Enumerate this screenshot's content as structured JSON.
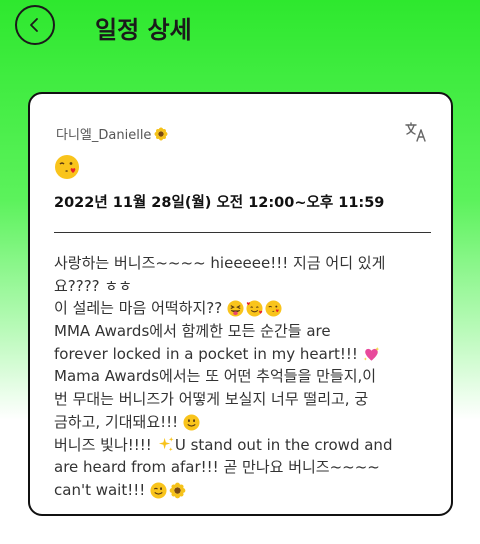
{
  "header": {
    "title": "일정 상세"
  },
  "card": {
    "author": "다니엘_Danielle",
    "datetime": "2022년 11월 28일(월) 오전 12:00~오후 11:59",
    "lines": [
      "사랑하는 버니즈~~~~ hieeeee!!! 지금 어디 있게",
      "요???? ㅎㅎ",
      "이 설레는 마음 어떡하지??",
      "MMA Awards에서 함께한 모든 순간들 are",
      "forever locked in a pocket in my heart!!!",
      "Mama Awards에서는 또 어떤 추억들을 만들지,이",
      "번 무대는 버니즈가 어떻게 보실지 너무 떨리고, 궁",
      "금하고, 기대돼요!!!",
      "버니즈 빛나!!!!",
      "U stand out in the crowd and",
      "are heard from afar!!! 곧 만나요 버니즈~~~~",
      "can't wait!!!"
    ]
  },
  "icons": {
    "back": "chevron-left-icon",
    "translate": "translate-icon",
    "author_badge": "sunflower-icon",
    "reaction": "kissing-face-icon"
  },
  "colors": {
    "accent_green": "#2ee82e",
    "text_dark": "#111111",
    "text_body": "#333333"
  }
}
